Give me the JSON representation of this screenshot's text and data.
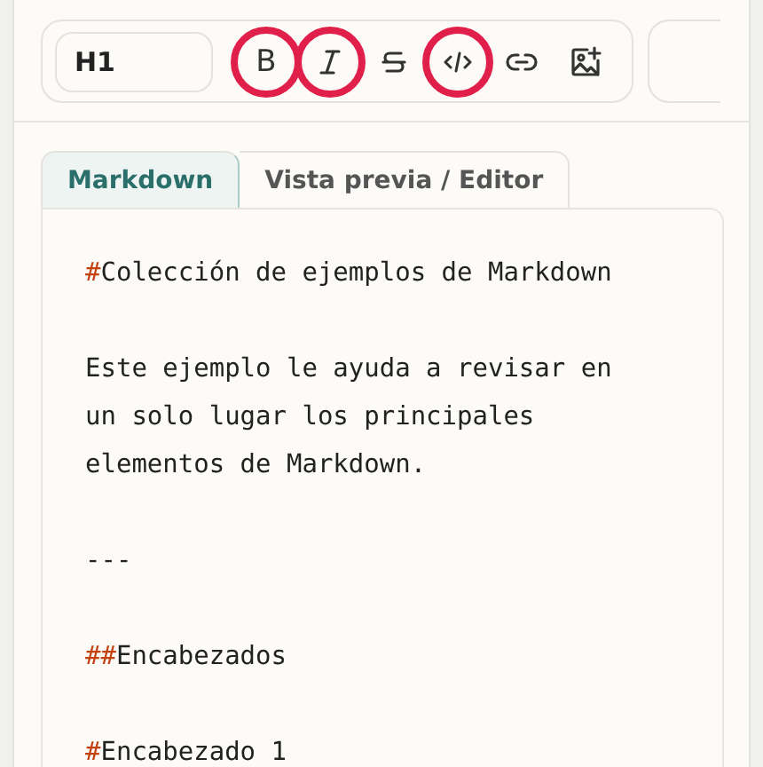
{
  "toolbar": {
    "heading_select": "H1",
    "tools": [
      {
        "kind": "bold",
        "label": "B",
        "annotated": true
      },
      {
        "kind": "italic",
        "annotated": true
      },
      {
        "kind": "strike",
        "annotated": false
      },
      {
        "kind": "code",
        "annotated": true
      },
      {
        "kind": "link",
        "annotated": false
      },
      {
        "kind": "image",
        "annotated": false
      }
    ]
  },
  "tabs": [
    {
      "label": "Markdown",
      "selected": true
    },
    {
      "label": "Vista previa / Editor",
      "selected": false
    }
  ],
  "editor": {
    "paragraphs": [
      {
        "marker": "#",
        "lines": [
          "Colección de ejemplos de Markdown"
        ]
      },
      {
        "lines": [
          "Este ejemplo le ayuda a revisar en",
          "un solo lugar los principales",
          "elementos de Markdown."
        ]
      },
      {
        "lines": [
          "---"
        ]
      },
      {
        "marker": "##",
        "lines": [
          "Encabezados"
        ]
      },
      {
        "marker": "#",
        "lines": [
          "Encabezado 1"
        ]
      }
    ]
  }
}
